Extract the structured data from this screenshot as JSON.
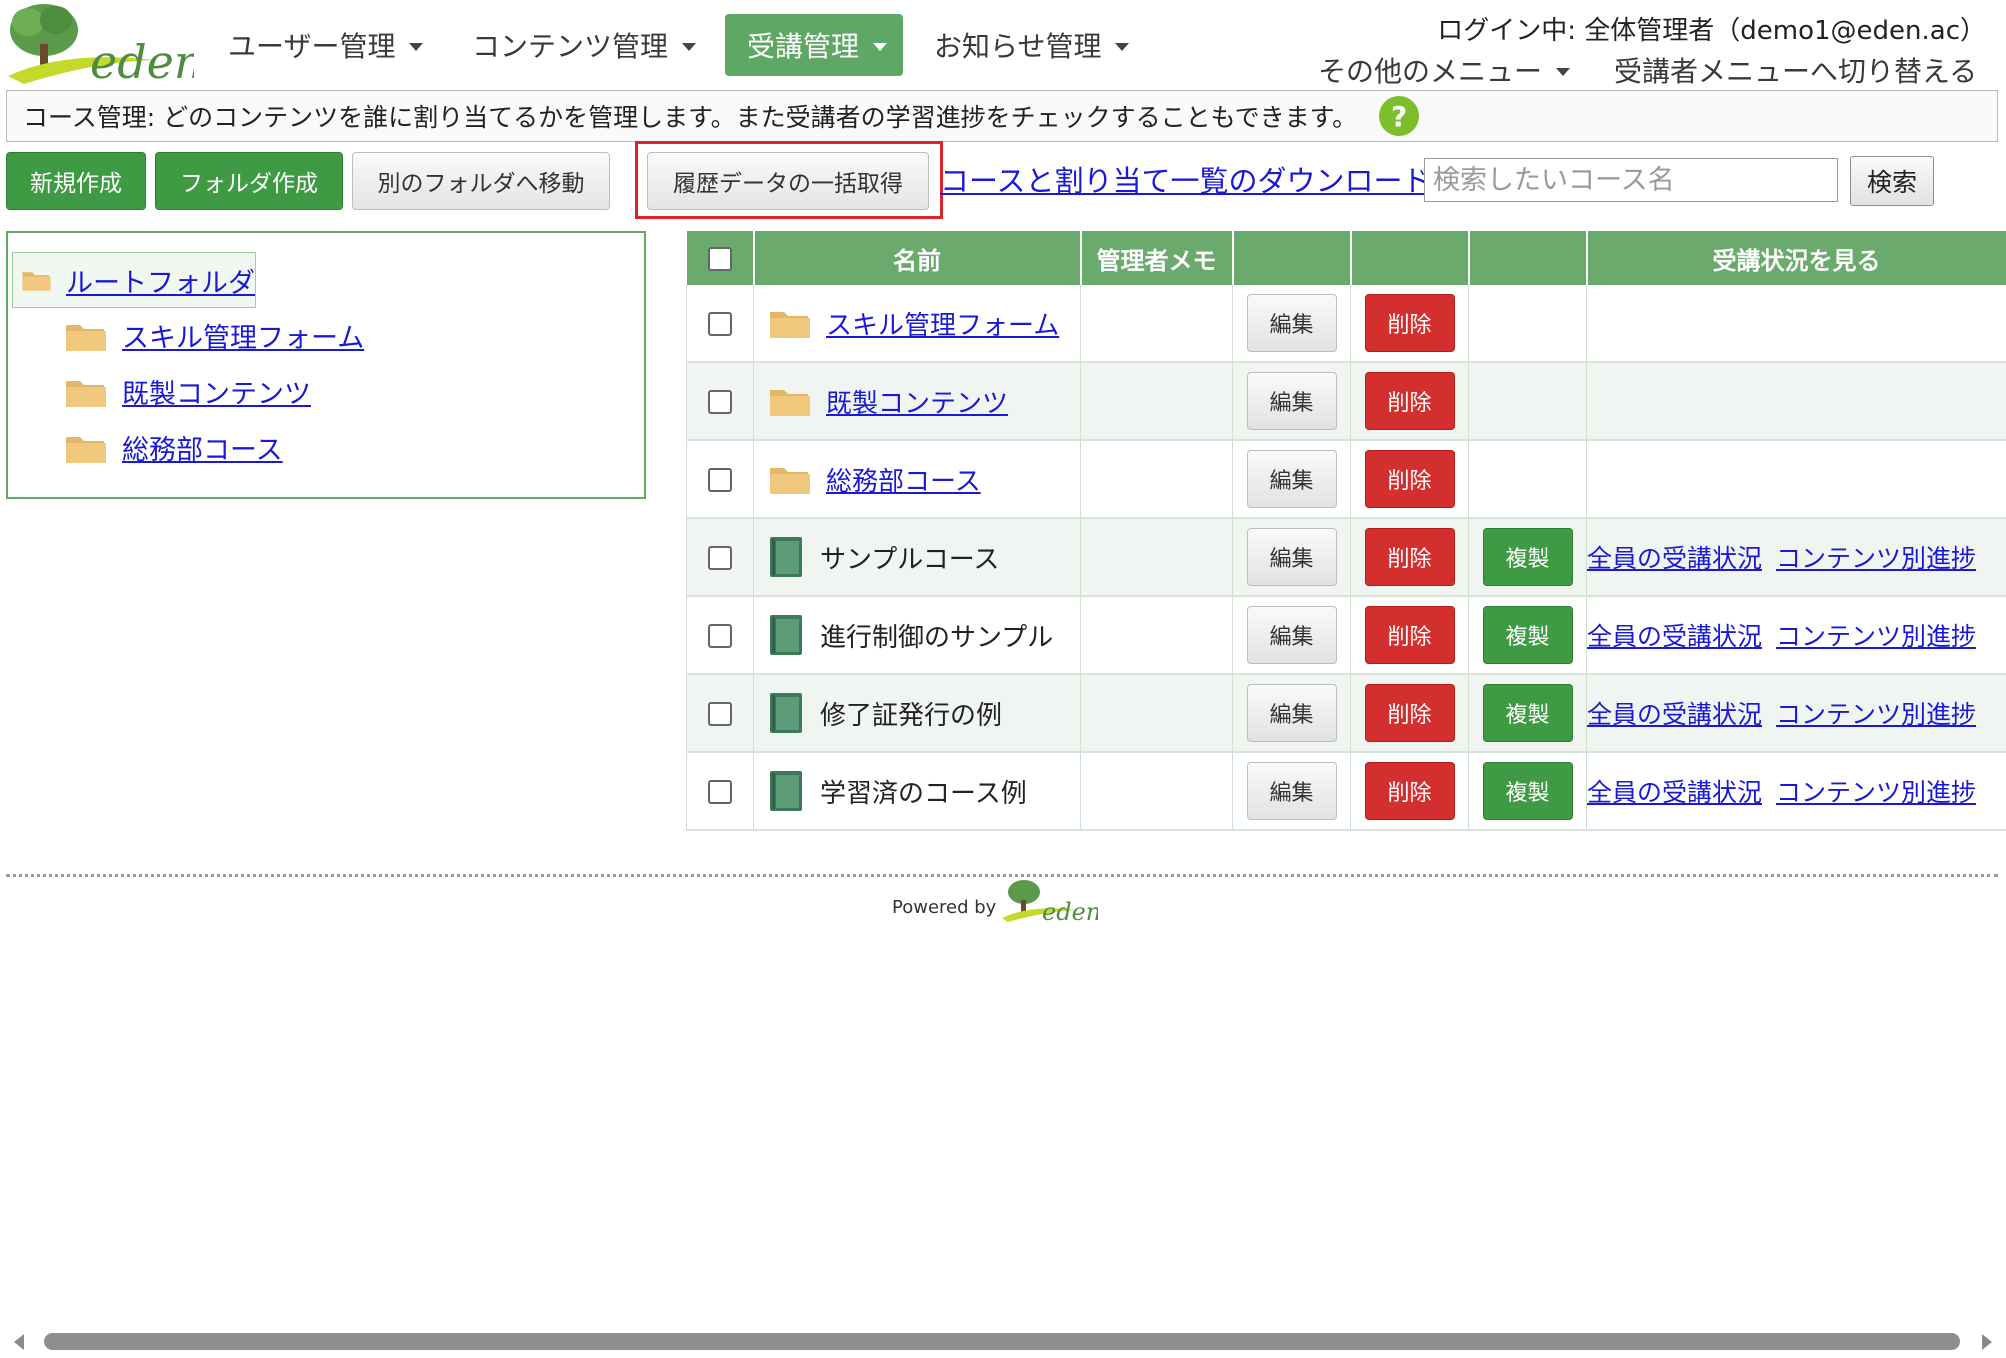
{
  "header": {
    "logo_text": "eden",
    "nav": [
      {
        "label": "ユーザー管理"
      },
      {
        "label": "コンテンツ管理"
      },
      {
        "label": "受講管理"
      },
      {
        "label": "お知らせ管理"
      }
    ],
    "login_status": "ログイン中: 全体管理者（demo1@eden.ac）",
    "other_menu": "その他のメニュー",
    "switch_menu": "受講者メニューへ切り替える"
  },
  "info_bar": {
    "text": "コース管理: どのコンテンツを誰に割り当てるかを管理します。また受講者の学習進捗をチェックすることもできます。",
    "help_icon": "?"
  },
  "toolbar": {
    "new_label": "新規作成",
    "folder_label": "フォルダ作成",
    "move_label": "別のフォルダへ移動",
    "history_label": "履歴データの一括取得",
    "download_link": "コースと割り当て一覧のダウンロード",
    "search_placeholder": "検索したいコース名",
    "search_label": "検索"
  },
  "tree": {
    "root": "ルートフォルダ",
    "children": [
      "スキル管理フォーム",
      "既製コンテンツ",
      "総務部コース"
    ]
  },
  "table": {
    "headers": {
      "name": "名前",
      "memo": "管理者メモ",
      "status": "受講状況を見る"
    },
    "buttons": {
      "edit": "編集",
      "delete": "削除",
      "copy": "複製"
    },
    "links": {
      "all_status": "全員の受講状況",
      "per_content": "コンテンツ別進捗"
    },
    "rows": [
      {
        "name": "スキル管理フォーム",
        "type": "folder"
      },
      {
        "name": "既製コンテンツ",
        "type": "folder"
      },
      {
        "name": "総務部コース",
        "type": "folder"
      },
      {
        "name": "サンプルコース",
        "type": "course"
      },
      {
        "name": "進行制御のサンプル",
        "type": "course"
      },
      {
        "name": "修了証発行の例",
        "type": "course"
      },
      {
        "name": "学習済のコース例",
        "type": "course"
      }
    ]
  },
  "footer": {
    "powered_by": "Powered by",
    "logo_text": "eden"
  },
  "colors": {
    "accent_green": "#5fa764",
    "button_green": "#3f9b43",
    "delete_red": "#d32f2f",
    "link_blue": "#1a1ad6",
    "highlight_red": "#e0222a"
  },
  "icons": {
    "folder": "folder-icon",
    "course": "book-icon",
    "help": "help-icon",
    "caret": "chevron-down-icon"
  }
}
